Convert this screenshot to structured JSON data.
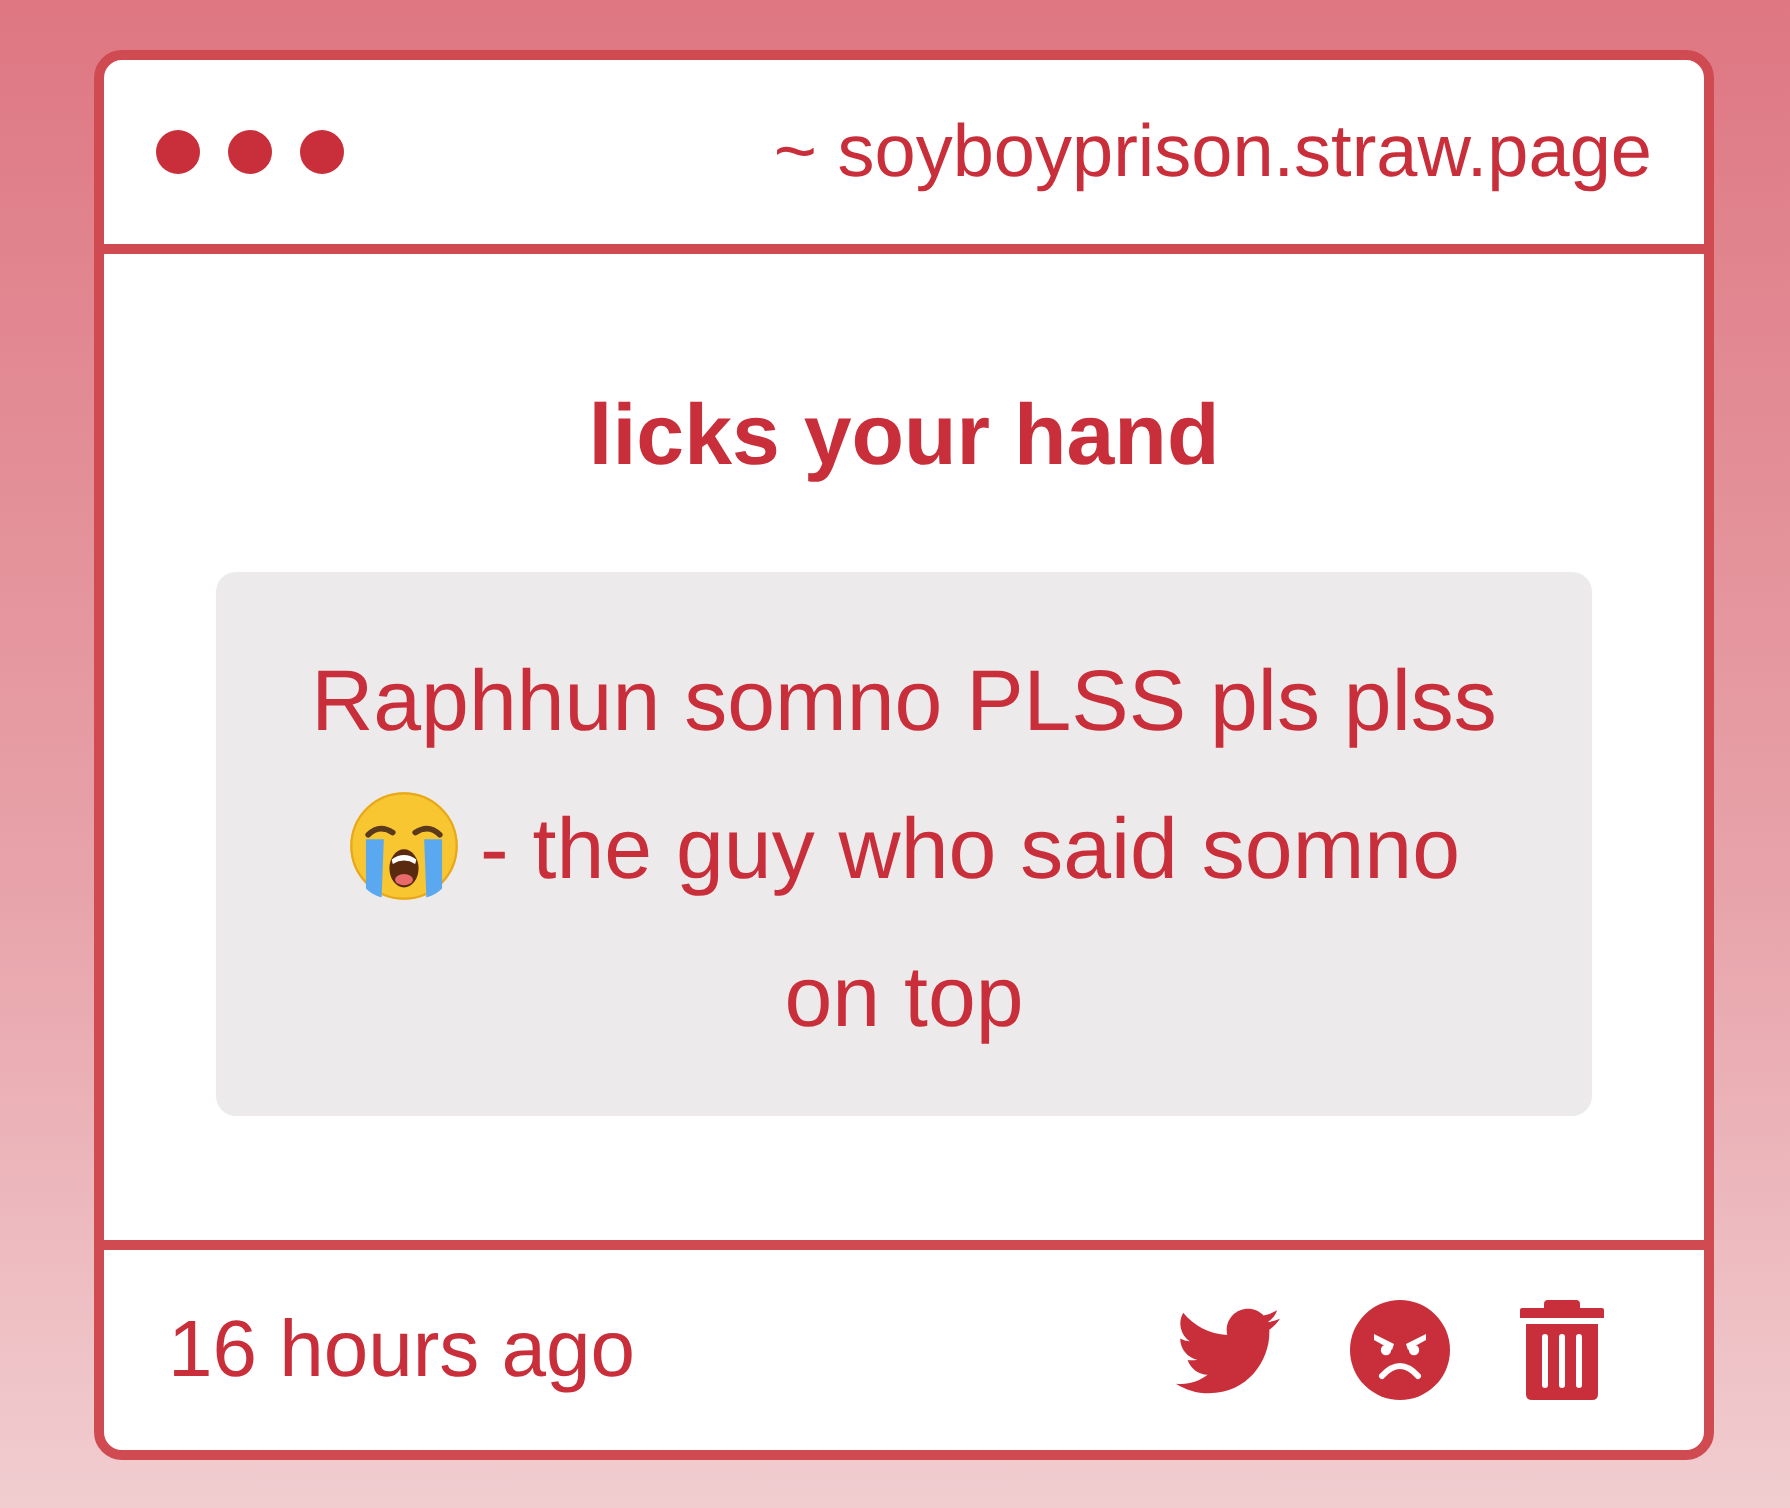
{
  "window": {
    "url": "~ soyboyprison.straw.page"
  },
  "post": {
    "title": "licks your hand",
    "message": {
      "text_before_icon": "Raphhun somno PLSS pls plss",
      "text_after_icon": "- the guy who said somno on top"
    }
  },
  "footer": {
    "time": "16 hours ago",
    "actions": [
      {
        "kind": "twitter"
      },
      {
        "kind": "react"
      },
      {
        "kind": "delete"
      }
    ]
  }
}
